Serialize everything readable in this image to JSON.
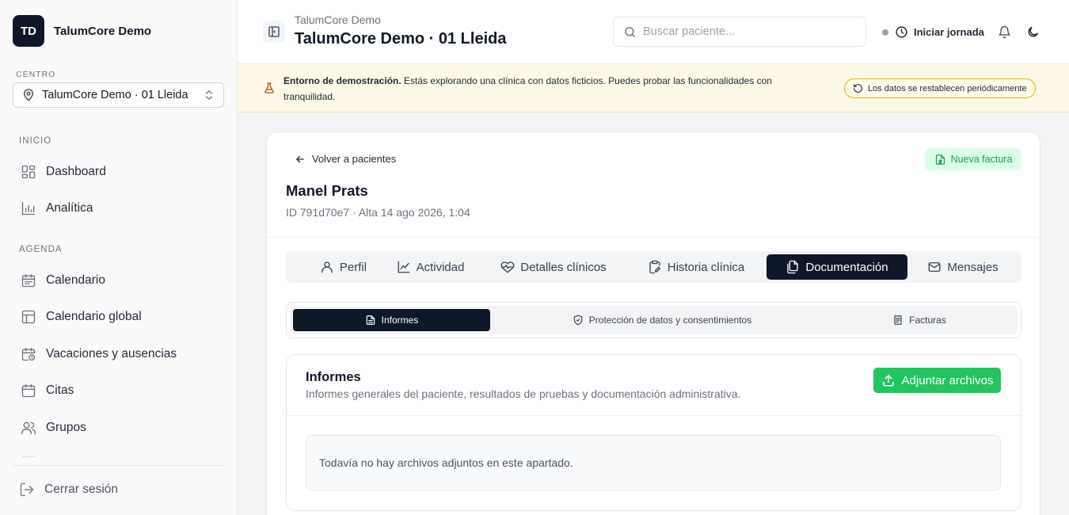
{
  "sidebar": {
    "logo_initials": "TD",
    "brand_name": "TalumCore Demo",
    "center_label": "CENTRO",
    "center_value": "TalumCore Demo · 01 Lleida",
    "sections": [
      {
        "label": "INICIO",
        "items": [
          {
            "label": "Dashboard",
            "icon": "dashboard-icon"
          },
          {
            "label": "Analítica",
            "icon": "chart-icon"
          }
        ]
      },
      {
        "label": "AGENDA",
        "items": [
          {
            "label": "Calendario",
            "icon": "calendar-icon"
          },
          {
            "label": "Calendario global",
            "icon": "layout-icon"
          },
          {
            "label": "Vacaciones y ausencias",
            "icon": "calendar-clock-icon"
          },
          {
            "label": "Citas",
            "icon": "calendar-icon"
          },
          {
            "label": "Grupos",
            "icon": "users-icon"
          }
        ]
      }
    ],
    "logout_label": "Cerrar sesión"
  },
  "header": {
    "subtitle": "TalumCore Demo",
    "title": "TalumCore Demo · 01 Lleida",
    "search_placeholder": "Buscar paciente...",
    "shift_label": "Iniciar jornada"
  },
  "banner": {
    "bold": "Entorno de demostración.",
    "text": " Estás explorando una clínica con datos ficticios. Puedes probar las funcionalidades con tranquilidad.",
    "pill": "Los datos se restablecen periódicamente"
  },
  "patient": {
    "back_label": "Volver a pacientes",
    "invoice_label": "Nueva factura",
    "name": "Manel Prats",
    "meta": "ID 791d70e7 · Alta 14 ago 2026, 1:04"
  },
  "tabs": [
    {
      "label": "Perfil",
      "active": false
    },
    {
      "label": "Actividad",
      "active": false
    },
    {
      "label": "Detalles clínicos",
      "active": false
    },
    {
      "label": "Historia clínica",
      "active": false
    },
    {
      "label": "Documentación",
      "active": true
    },
    {
      "label": "Mensajes",
      "active": false
    }
  ],
  "subtabs": [
    {
      "label": "Informes",
      "active": true
    },
    {
      "label": "Protección de datos y consentimientos",
      "active": false
    },
    {
      "label": "Facturas",
      "active": false
    }
  ],
  "reports": {
    "title": "Informes",
    "description": "Informes generales del paciente, resultados de pruebas y documentación administrativa.",
    "attach_label": "Adjuntar archivos",
    "empty_text": "Todavía no hay archivos adjuntos en este apartado."
  },
  "colors": {
    "primary_dark": "#0f172a",
    "accent_green": "#22c55e",
    "banner_bg": "#fef9e7",
    "banner_border": "#eab308"
  }
}
